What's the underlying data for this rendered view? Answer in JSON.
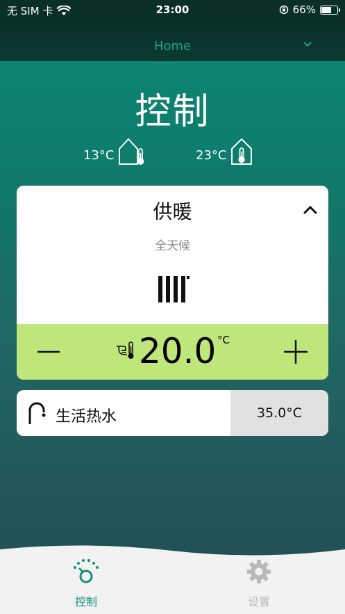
{
  "status_bar": {
    "carrier": "无 SIM 卡",
    "time": "23:00",
    "battery": "66%",
    "battery_level": 0.66
  },
  "header": {
    "home_selector": "Home"
  },
  "main": {
    "title": "控制",
    "outdoor_temp": "13°C",
    "indoor_temp": "23°C"
  },
  "heating": {
    "title": "供暖",
    "mode": "全天候",
    "setpoint": "20.0",
    "unit": "°C"
  },
  "hot_water": {
    "label": "生活热水",
    "temperature": "35.0°C"
  },
  "tabs": [
    {
      "label": "控制",
      "active": true
    },
    {
      "label": "设置",
      "active": false
    }
  ],
  "colors": {
    "accent": "#168f7b",
    "setpoint_bar": "#bfe67a",
    "inactive_tab": "#b9b9b9"
  }
}
